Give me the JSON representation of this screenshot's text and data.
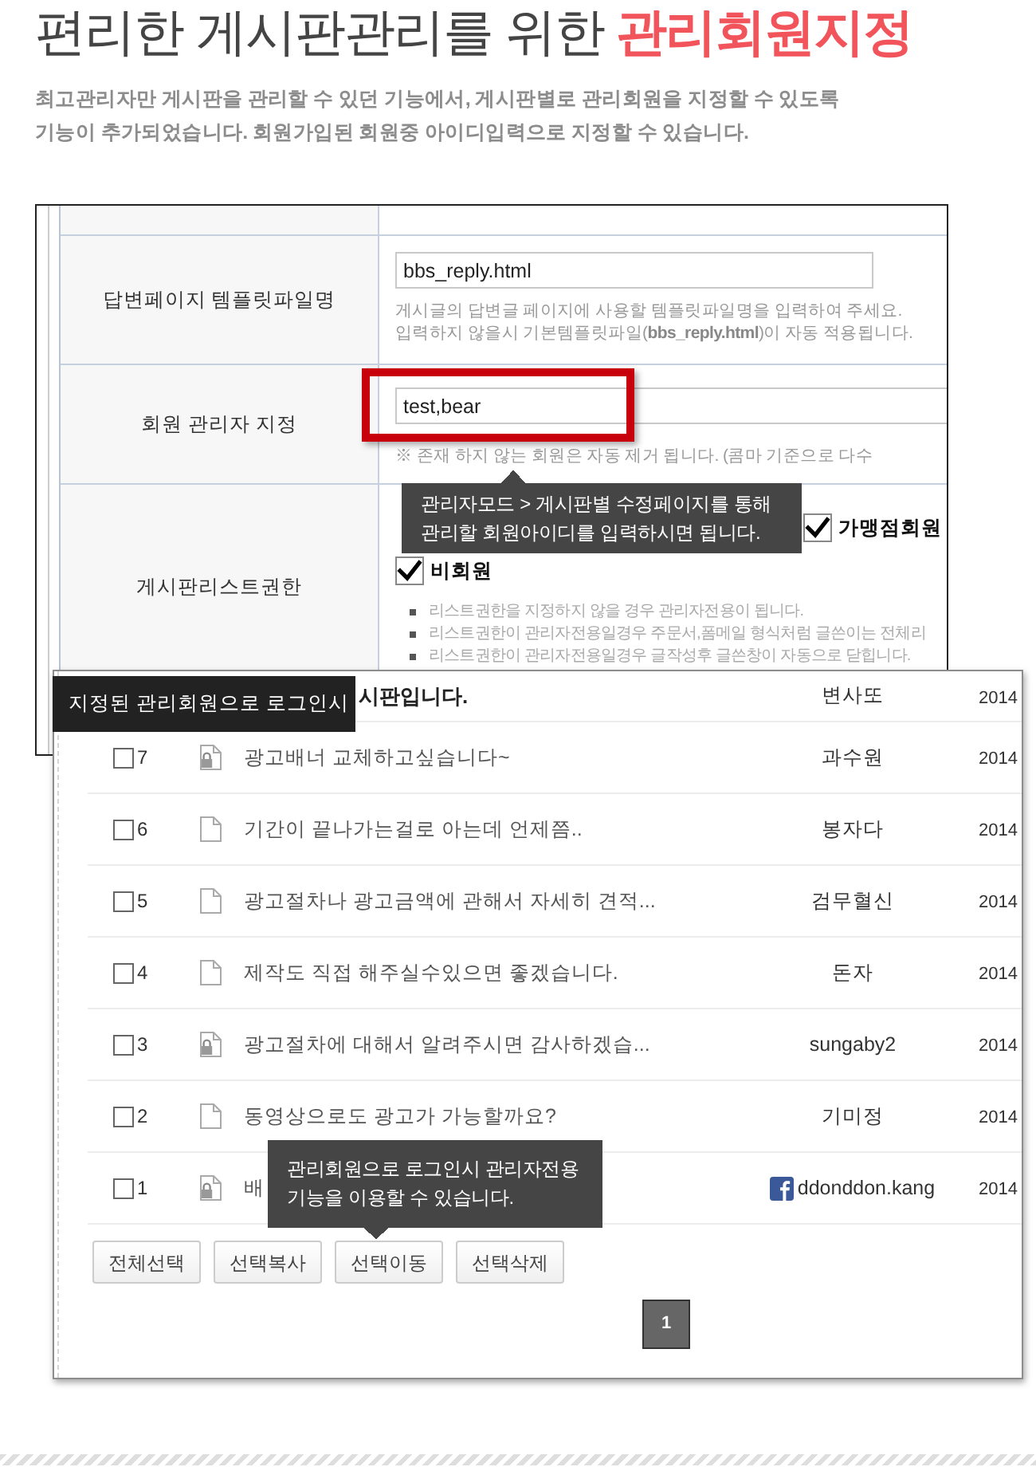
{
  "heading": "편리한 게시판관리를 위한 **관리회원지정**",
  "description": "최고관리자만 게시판을 관리할 수 있던 기능에서, 게시판별로 관리회원을 지정할 수 있도록\n기능이 추가되었습니다. 회원가입된 회원중 아이디입력으로 지정할 수 있습니다.",
  "settings_panel": {
    "rows": [
      {
        "kind": "text_input",
        "label": "답변페이지 템플릿파일명",
        "value": "bbs_reply.html",
        "help": [
          "게시글의 답변글 페이지에 사용할 템플릿파일명을 입력하여 주세요.",
          "입력하지 않을시 기본템플릿파일(**bbs_reply.html**)이 자동 적용됩니다."
        ]
      },
      {
        "kind": "text_input",
        "label": "회원 관리자 지정",
        "value": "test,bear",
        "highlighted": true,
        "help": [
          "※ 존재 하지 않는 회원은 자동 제거 됩니다. (콤마 기준으로 다수"
        ],
        "tooltip": "관리자모드 > 게시판별 수정페이지를 통해\n관리할 회원아이디를 입력하시면 됩니다."
      },
      {
        "kind": "checkboxes",
        "label": "게시판리스트권한",
        "checkboxes": [
          {
            "label": "가맹점회원",
            "checked": true
          },
          {
            "label": "비회원",
            "checked": true
          }
        ],
        "notes": [
          "리스트권한을 지정하지 않을 경우 관리자전용이 됩니다.",
          "리스트권한이 관리자전용일경우 주문서,폼메일 형식처럼 글쓴이는 전체리",
          "리스트권한이 관리자전용일경우 글작성후 글쓴창이 자동으로 닫힙니다."
        ]
      }
    ]
  },
  "list_panel": {
    "banner": "지정된 관리회원으로 로그인시",
    "posts": [
      {
        "kind": "notice",
        "title": "시판입니다.",
        "author": "변사또",
        "date": "2014"
      },
      {
        "kind": "post",
        "number": "7",
        "checked": false,
        "locked": true,
        "title": "광고배너 교체하고싶습니다~",
        "author": "과수원",
        "date": "2014"
      },
      {
        "kind": "post",
        "number": "6",
        "checked": false,
        "locked": false,
        "title": "기간이 끝나가는걸로 아는데 언제쯤..",
        "author": "봉자다",
        "date": "2014"
      },
      {
        "kind": "post",
        "number": "5",
        "checked": false,
        "locked": false,
        "title": "광고절차나 광고금액에 관해서 자세히 견적...",
        "author": "검무혈신",
        "date": "2014"
      },
      {
        "kind": "post",
        "number": "4",
        "checked": false,
        "locked": false,
        "title": "제작도 직접 해주실수있으면 좋겠습니다.",
        "author": "돈자",
        "date": "2014"
      },
      {
        "kind": "post",
        "number": "3",
        "checked": false,
        "locked": true,
        "title": "광고절차에 대해서 알려주시면 감사하겠습...",
        "author": "sungaby2",
        "date": "2014"
      },
      {
        "kind": "post",
        "number": "2",
        "checked": false,
        "locked": false,
        "title": "동영상으로도 광고가 가능할까요?",
        "author": "기미정",
        "date": "2014"
      },
      {
        "kind": "post",
        "number": "1",
        "checked": false,
        "locked": true,
        "title": "배",
        "author": "ddonddon.kang",
        "facebook": true,
        "date": "2014"
      }
    ],
    "tooltip": "관리회원으로 로그인시 관리자전용\n기능을 이용할 수 있습니다.",
    "buttons": [
      "전체선택",
      "선택복사",
      "선택이동",
      "선택삭제"
    ],
    "pages": [
      {
        "label": "1",
        "selected": true
      }
    ]
  }
}
